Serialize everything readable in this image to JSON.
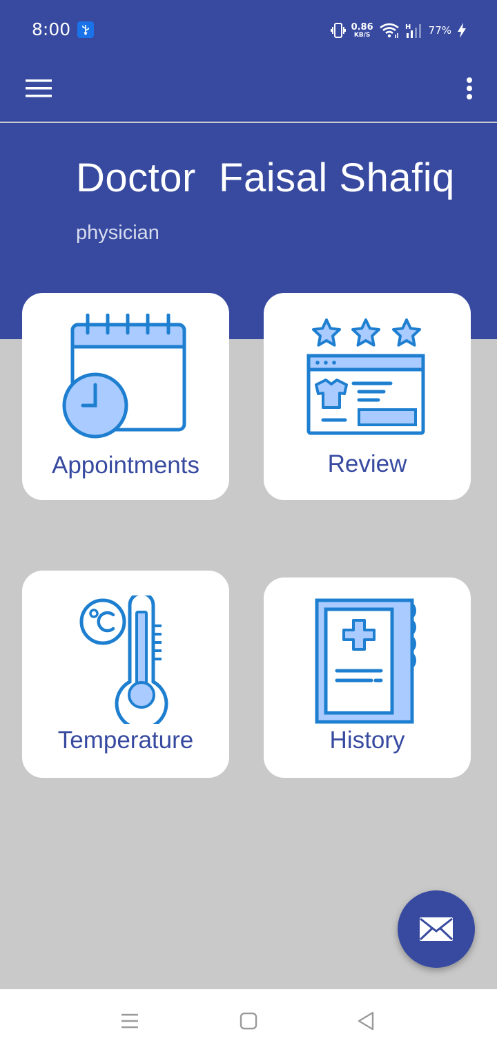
{
  "status_bar": {
    "time": "8:00",
    "usb_icon": "usb-icon",
    "net_speed": "0.86",
    "net_speed_unit": "KB/S",
    "network_type": "H",
    "battery": "77%"
  },
  "app_bar": {
    "menu_icon": "hamburger-menu-icon",
    "more_icon": "more-vert-icon"
  },
  "profile": {
    "name": "Doctor  Faisal Shafiq",
    "role": "physician"
  },
  "dashboard": {
    "cards": [
      {
        "label": "Appointments",
        "icon": "calendar-clock-icon"
      },
      {
        "label": "Review",
        "icon": "star-review-icon"
      },
      {
        "label": "Temperature",
        "icon": "thermometer-icon"
      },
      {
        "label": "History",
        "icon": "medical-history-icon"
      }
    ]
  },
  "fab": {
    "icon": "mail-icon"
  },
  "nav_bar": {
    "recents_icon": "recents-icon",
    "home_icon": "home-icon",
    "back_icon": "back-icon"
  },
  "colors": {
    "primary": "#374aa0",
    "icon_blue": "#1e7fd0",
    "icon_fill": "#a9cbff",
    "background": "#c9c9c9"
  }
}
